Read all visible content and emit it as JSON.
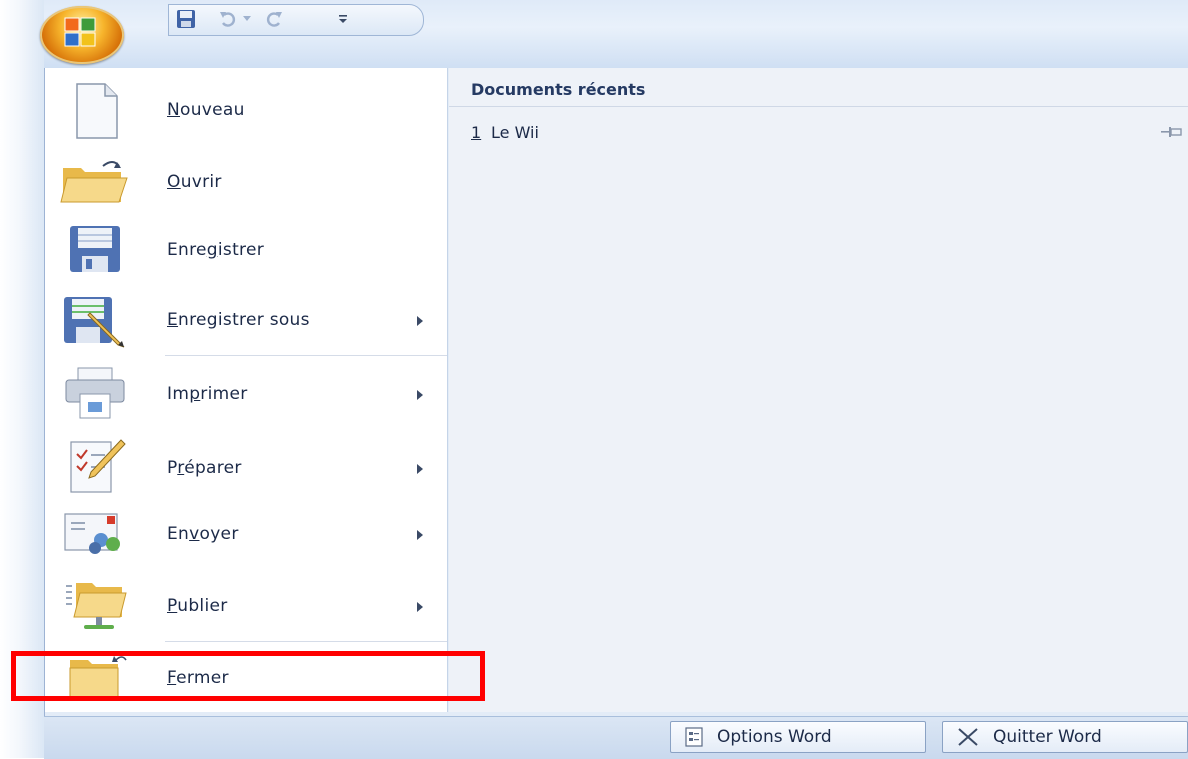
{
  "quick_access_toolbar": {
    "icons": [
      "save-icon",
      "undo-icon",
      "undo-dropdown-icon",
      "redo-icon",
      "customize-dropdown-icon"
    ]
  },
  "office_button": {
    "icon": "office-logo-icon"
  },
  "menu": {
    "items": [
      {
        "label": "Nouveau",
        "access_key": "N",
        "icon": "new-document-icon",
        "has_submenu": false
      },
      {
        "label": "Ouvrir",
        "access_key": "O",
        "icon": "open-folder-icon",
        "has_submenu": false
      },
      {
        "label": "Enregistrer",
        "access_key": "g",
        "icon": "save-disk-icon",
        "has_submenu": false
      },
      {
        "label": "Enregistrer sous",
        "access_key": "E",
        "icon": "save-as-icon",
        "has_submenu": true
      },
      {
        "label": "Imprimer",
        "access_key": "p",
        "icon": "printer-icon",
        "has_submenu": true
      },
      {
        "label": "Préparer",
        "access_key": "r",
        "icon": "prepare-icon",
        "has_submenu": true
      },
      {
        "label": "Envoyer",
        "access_key": "v",
        "icon": "send-icon",
        "has_submenu": true
      },
      {
        "label": "Publier",
        "access_key": "P",
        "icon": "publish-folder-icon",
        "has_submenu": true
      },
      {
        "label": "Fermer",
        "access_key": "F",
        "icon": "close-folder-icon",
        "has_submenu": false
      }
    ]
  },
  "recent_documents": {
    "title": "Documents récents",
    "items": [
      {
        "number": "1",
        "name": "Le Wii",
        "icon": "pin-icon"
      }
    ]
  },
  "footer": {
    "options_label": "Options Word",
    "quit_label": "Quitter Word",
    "options_icon": "options-icon",
    "quit_icon": "close-x-icon"
  },
  "highlight": {
    "target": "Fermer",
    "color": "#ff0000"
  },
  "colors": {
    "accent": "#f7b52c",
    "panel": "#e3ecf7",
    "text": "#1c2a48"
  }
}
